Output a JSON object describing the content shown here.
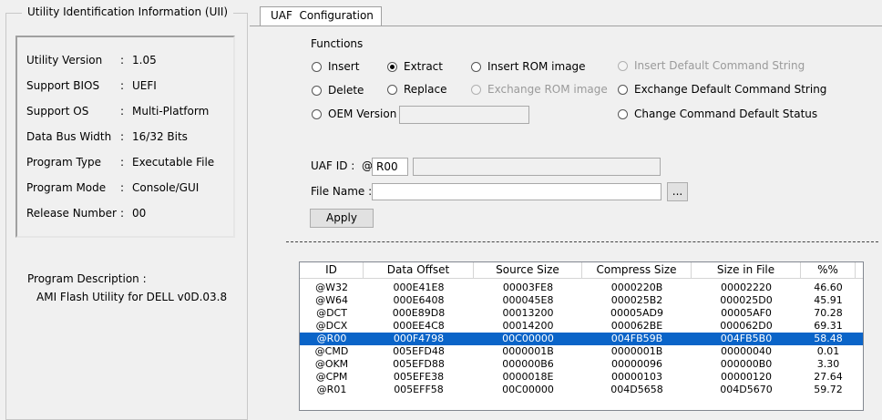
{
  "uii": {
    "title": "Utility Identification Information (UII)",
    "rows": [
      {
        "label": "Utility Version",
        "value": "1.05"
      },
      {
        "label": "Support BIOS",
        "value": "UEFI"
      },
      {
        "label": "Support OS",
        "value": "Multi-Platform"
      },
      {
        "label": "Data Bus Width",
        "value": "16/32 Bits"
      },
      {
        "label": "Program Type",
        "value": "Executable File"
      },
      {
        "label": "Program Mode",
        "value": "Console/GUI"
      },
      {
        "label": "Release Number",
        "value": "00"
      }
    ],
    "desc_label": "Program Description :",
    "desc_value": "AMI Flash Utility for DELL v0D.03.8"
  },
  "tab": {
    "label": "UAF  Configuration"
  },
  "functions": {
    "title": "Functions",
    "insert": "Insert",
    "extract": "Extract",
    "insert_rom": "Insert ROM image",
    "insert_default_cmd": "Insert Default Command String",
    "delete": "Delete",
    "replace": "Replace",
    "exchange_rom": "Exchange ROM image",
    "exchange_default_cmd": "Exchange Default Command String",
    "oem_version": "OEM Version",
    "change_cmd_default": "Change Command Default Status",
    "selected": "extract"
  },
  "form": {
    "uaf_id_label": "UAF ID :",
    "at_sign": "@",
    "uaf_id_value": "R00",
    "file_name_label": "File Name :",
    "file_name_value": "",
    "browse_label": "...",
    "apply_label": "Apply"
  },
  "table": {
    "columns": [
      "ID",
      "Data Offset",
      "Source Size",
      "Compress Size",
      "Size in File",
      "%%"
    ],
    "rows": [
      [
        "@W32",
        "000E41E8",
        "00003FE8",
        "0000220B",
        "00002220",
        "46.60"
      ],
      [
        "@W64",
        "000E6408",
        "000045E8",
        "000025B2",
        "000025D0",
        "45.91"
      ],
      [
        "@DCT",
        "000E89D8",
        "00013200",
        "00005AD9",
        "00005AF0",
        "70.28"
      ],
      [
        "@DCX",
        "000EE4C8",
        "00014200",
        "000062BE",
        "000062D0",
        "69.31"
      ],
      [
        "@R00",
        "000F4798",
        "00C00000",
        "004FB59B",
        "004FB5B0",
        "58.48"
      ],
      [
        "@CMD",
        "005EFD48",
        "0000001B",
        "0000001B",
        "00000040",
        "0.01"
      ],
      [
        "@OKM",
        "005EFD88",
        "000000B6",
        "00000096",
        "000000B0",
        "3.30"
      ],
      [
        "@CPM",
        "005EFE38",
        "0000018E",
        "00000103",
        "00000120",
        "27.64"
      ],
      [
        "@R01",
        "005EFF58",
        "00C00000",
        "004D5658",
        "004D5670",
        "59.72"
      ]
    ],
    "selected_index": 4
  }
}
